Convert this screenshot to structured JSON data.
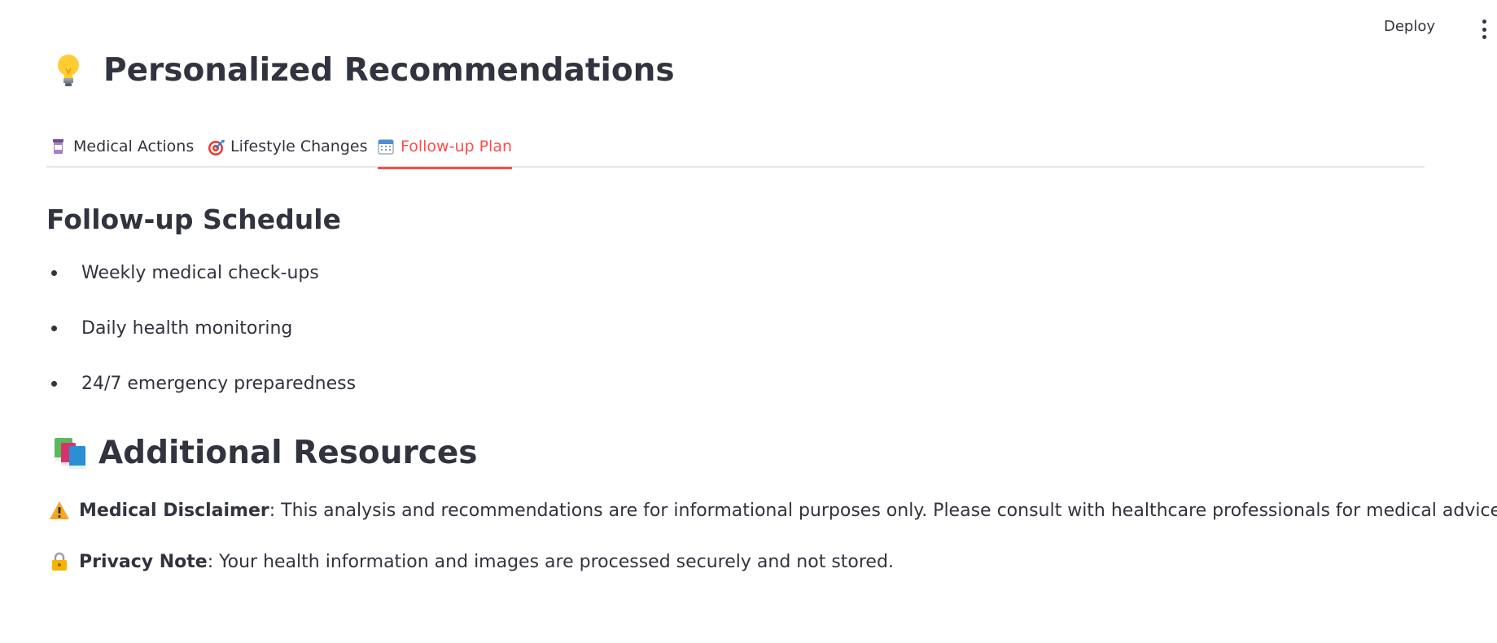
{
  "toolbar": {
    "deploy_label": "Deploy",
    "menu_icon": "more-vertical-icon"
  },
  "page": {
    "title": "Personalized Recommendations",
    "title_icon": "lightbulb-icon"
  },
  "tabs": [
    {
      "label": "Medical Actions",
      "icon": "pill-bottle-icon",
      "active": false
    },
    {
      "label": "Lifestyle Changes",
      "icon": "target-icon",
      "active": false
    },
    {
      "label": "Follow-up Plan",
      "icon": "calendar-icon",
      "active": true
    }
  ],
  "follow_up": {
    "heading": "Follow-up Schedule",
    "items": [
      "Weekly medical check-ups",
      "Daily health monitoring",
      "24/7 emergency preparedness"
    ]
  },
  "resources": {
    "heading": "Additional Resources",
    "heading_icon": "books-icon",
    "disclaimer": {
      "icon": "warning-icon",
      "label": "Medical Disclaimer",
      "text": ": This analysis and recommendations are for informational purposes only. Please consult with healthcare professionals for medical advice."
    },
    "privacy": {
      "icon": "lock-icon",
      "label": "Privacy Note",
      "text": ": Your health information and images are processed securely and not stored."
    }
  },
  "colors": {
    "accent": "#ff4b4b",
    "text": "#31333f",
    "divider": "#e6e6ea"
  }
}
